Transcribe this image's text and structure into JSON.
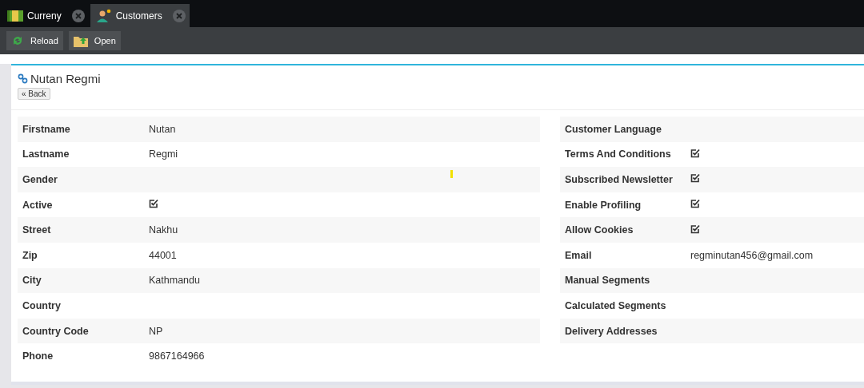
{
  "tabs": [
    {
      "label": "Curreny",
      "kind": "money",
      "selected": false
    },
    {
      "label": "Customers",
      "kind": "person",
      "selected": true
    }
  ],
  "toolbar": [
    {
      "label": "Reload",
      "kind": "reload"
    },
    {
      "label": "Open",
      "kind": "folder"
    }
  ],
  "record": {
    "title": "Nutan Regmi",
    "back": "« Back"
  },
  "left_fields": [
    {
      "label": "Firstname",
      "kind": "text",
      "value": "Nutan"
    },
    {
      "label": "Lastname",
      "kind": "text",
      "value": "Regmi"
    },
    {
      "label": "Gender",
      "kind": "text"
    },
    {
      "label": "Active",
      "kind": "check",
      "checked": true
    },
    {
      "label": "Street",
      "kind": "text",
      "value": "Nakhu"
    },
    {
      "label": "Zip",
      "kind": "text",
      "value": "44001"
    },
    {
      "label": "City",
      "kind": "text",
      "value": "Kathmandu"
    },
    {
      "label": "Country",
      "kind": "text"
    },
    {
      "label": "Country Code",
      "kind": "text",
      "value": "NP"
    },
    {
      "label": "Phone",
      "kind": "text",
      "value": "9867164966"
    }
  ],
  "right_fields": [
    {
      "label": "Customer Language",
      "kind": "text"
    },
    {
      "label": "Terms And Conditions",
      "kind": "check",
      "checked": true
    },
    {
      "label": "Subscribed Newsletter",
      "kind": "check",
      "checked": true
    },
    {
      "label": "Enable Profiling",
      "kind": "check",
      "checked": true
    },
    {
      "label": "Allow Cookies",
      "kind": "check",
      "checked": true
    },
    {
      "label": "Email",
      "kind": "text",
      "value": "regminutan456@gmail.com"
    },
    {
      "label": "Manual Segments",
      "kind": "text"
    },
    {
      "label": "Calculated Segments",
      "kind": "text"
    },
    {
      "label": "Delivery Addresses",
      "kind": "text"
    }
  ]
}
